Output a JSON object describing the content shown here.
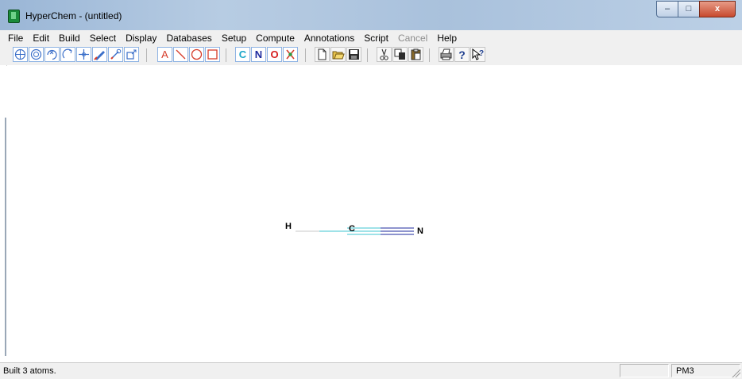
{
  "window": {
    "title": "HyperChem - (untitled)",
    "controls": [
      "–",
      "□",
      "x"
    ]
  },
  "menu": [
    "File",
    "Edit",
    "Build",
    "Select",
    "Display",
    "Databases",
    "Setup",
    "Compute",
    "Annotations",
    "Script",
    "Cancel",
    "Help"
  ],
  "toolbar": {
    "element_buttons": [
      "C",
      "N",
      "O"
    ],
    "text_tool_label": "A"
  },
  "molecule": {
    "atoms": [
      "H",
      "C",
      "N"
    ],
    "bonds": [
      {
        "from": "H",
        "to": "C",
        "order": 1
      },
      {
        "from": "C",
        "to": "N",
        "order": 3
      }
    ]
  },
  "status": {
    "message": "Built 3 atoms.",
    "method": "PM3"
  },
  "colors": {
    "titlebar": "#b7cce3",
    "carbon_bond": "#3fc6d2",
    "nitrogen_bond": "#1e2a9e",
    "hydrogen_bond": "#c8c8c8"
  }
}
